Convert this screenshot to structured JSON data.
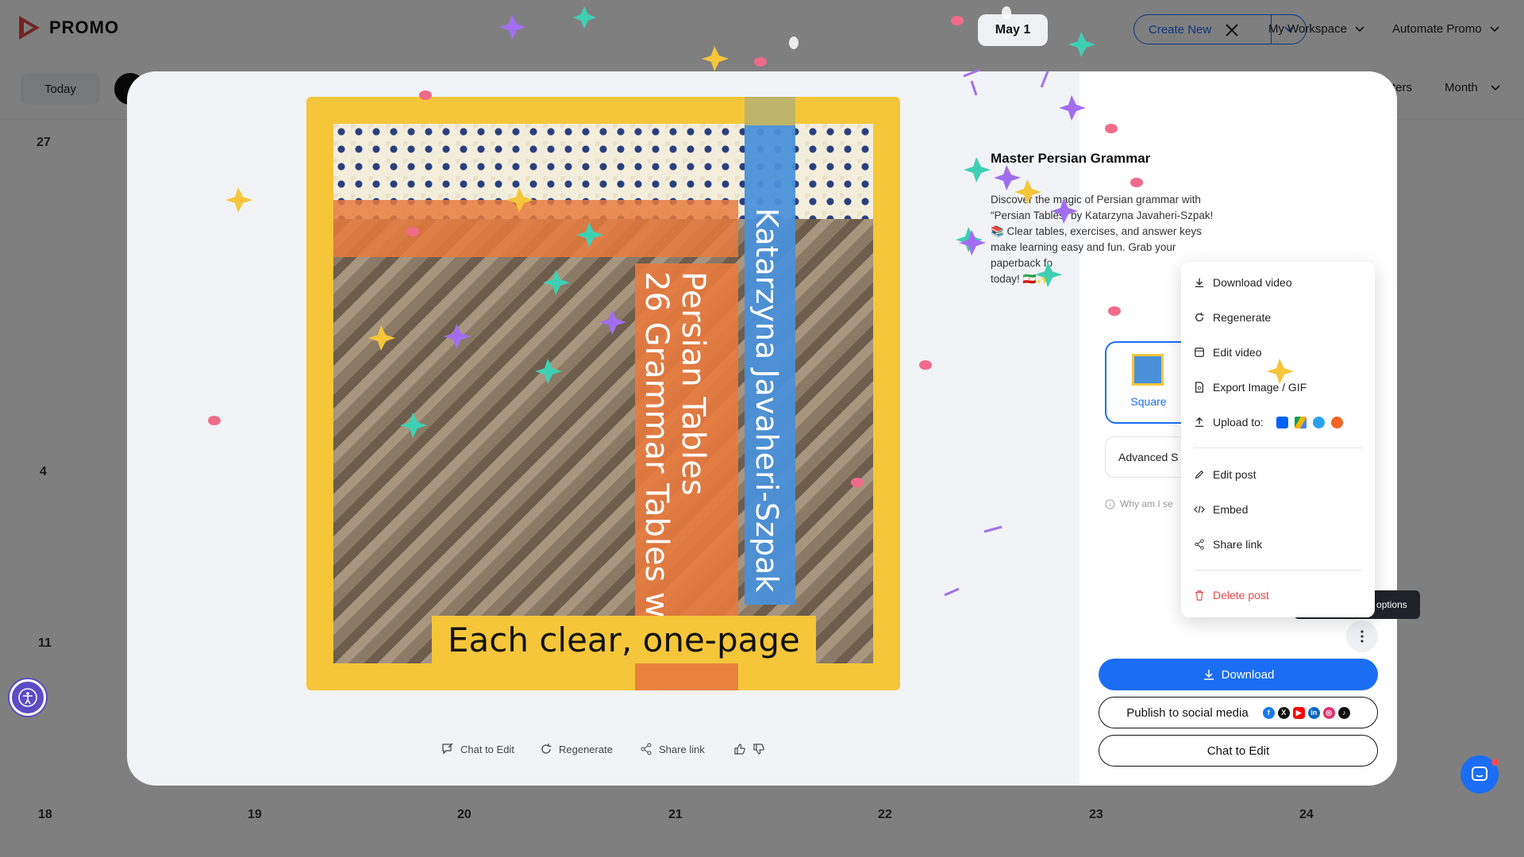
{
  "app": {
    "brand": "PROMO"
  },
  "topbar": {
    "create_new": "Create New",
    "my_workspace": "My Workspace",
    "automate_promo": "Automate Promo"
  },
  "subbar": {
    "today": "Today",
    "filters_partial": "ters",
    "view": "Month"
  },
  "calendar": {
    "day_27": "27",
    "day_4": "4",
    "day_11": "11",
    "week4": [
      "18",
      "19",
      "20",
      "21",
      "22",
      "23",
      "24"
    ]
  },
  "video": {
    "author": "Katarzyna Javaheri-Szpak",
    "title_line1": "Persian Tables",
    "title_line2": "26 Grammar Tables w",
    "caption": "Each clear, one-page"
  },
  "video_actions": {
    "chat_to_edit": "Chat to Edit",
    "regenerate": "Regenerate",
    "share_link": "Share link"
  },
  "post": {
    "date": "May 1",
    "title": "Master Persian Grammar",
    "description_lines": [
      "Discover the magic of Persian grammar with",
      "“Persian Tables” by Katarzyna Javaheri-Szpak!",
      "📚 Clear tables, exercises, and answer keys",
      "make learning easy and fun. Grab your",
      "paperback fo",
      "today! 🇮🇷✨"
    ],
    "format_label": "Square",
    "advanced_partial": "Advanced S",
    "why_partial": "Why am I se"
  },
  "menu": {
    "download_video": "Download video",
    "regenerate": "Regenerate",
    "edit_video": "Edit video",
    "export_image": "Export Image / GIF",
    "upload_to": "Upload to:",
    "edit_post": "Edit post",
    "embed": "Embed",
    "share_link": "Share link",
    "delete_post": "Delete post"
  },
  "tooltip": "More publishing options",
  "actions": {
    "download": "Download",
    "publish": "Publish to social media",
    "chat_to_edit": "Chat to Edit"
  },
  "colors": {
    "accent": "#1b6ef3",
    "danger": "#e5484d",
    "video_yellow": "#f5c63a",
    "video_orange": "#e87a3e",
    "video_blue": "#4a90d9"
  }
}
